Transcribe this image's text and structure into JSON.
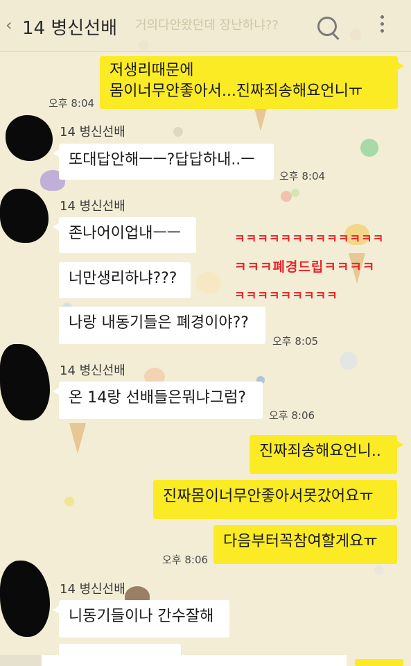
{
  "header": {
    "back_label": "‹",
    "title": "14 병신선배",
    "ghost_text": "거의다안왔던데 장난하냐??",
    "search_icon": "search-icon",
    "menu_icon": "more-vertical-icon"
  },
  "overlay": {
    "line1": "ㅋㅋㅋㅋㅋㅋㅋㅋㅋㅋㅋㅋㅋ",
    "line2": "ㅋㅋㅋ폐경드립ㅋㅋㅋㅋ",
    "line3": "ㅋㅋㅋㅋㅋㅋㅋㅋㅋ"
  },
  "messages": {
    "m1": {
      "line1": "저생리때문에",
      "line2": "몸이너무안좋아서...진짜죄송해요언니ㅠ",
      "time": "오후 8:04"
    },
    "g1": {
      "sender": "14 병신선배",
      "m1": "또대답안해ㅡㅡ?답답하내..ㅡ",
      "time": "오후 8:04"
    },
    "g2": {
      "sender": "14 병신선배",
      "m1": "존나어이업내ㅡㅡ",
      "m2": "너만생리하냐???",
      "m3": "나랑 내동기들은 폐경이야??",
      "time": "오후 8:05"
    },
    "g3": {
      "sender": "14 병신선배",
      "m1": "온 14랑 선배들은뭐냐그럼?",
      "time": "오후 8:06"
    },
    "m2": {
      "l1": "진짜죄송해요언니..",
      "l2": "진짜몸이너무안좋아서못갔어요ㅠ",
      "l3": "다음부터꼭참여할게요ㅠ",
      "time": "오후 8:06"
    },
    "g4": {
      "sender": "14 병신선배",
      "m1": "니동기들이나 간수잘해"
    }
  },
  "colors": {
    "background": "#f3edd5",
    "my_bubble": "#fbeb24",
    "their_bubble": "#ffffff",
    "overlay_text": "#e8262c"
  }
}
